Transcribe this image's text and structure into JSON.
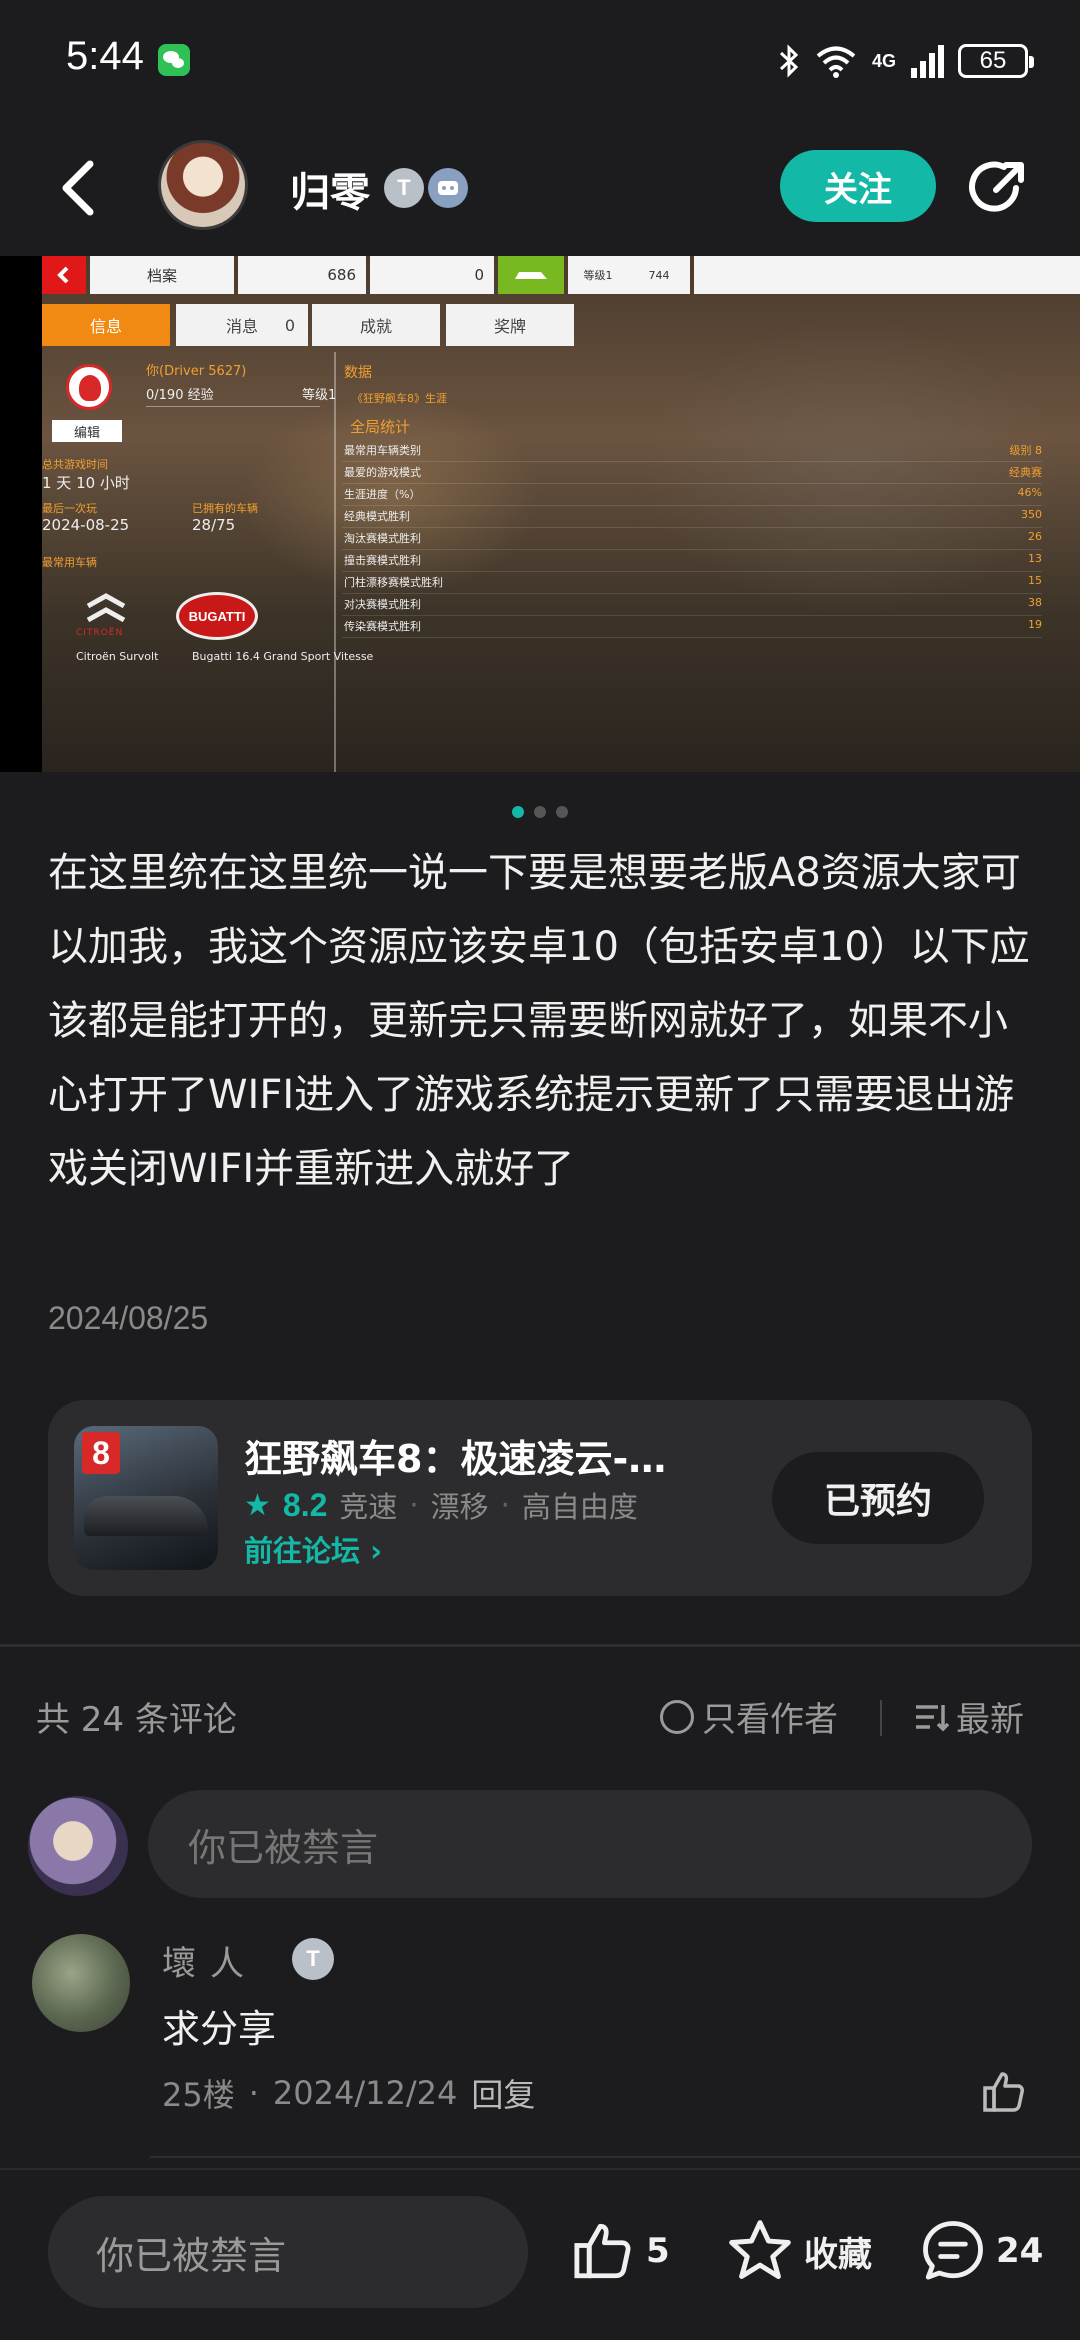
{
  "status_bar": {
    "time": "5:44",
    "network": "4G",
    "battery": "65"
  },
  "header": {
    "username": "归零",
    "badge_level": "T",
    "follow_label": "关注"
  },
  "screenshot": {
    "tabs_top": [
      "档案",
      "686",
      "0",
      "等级1",
      "744"
    ],
    "tabs": [
      "信息",
      "消息",
      "0",
      "成就",
      "奖牌"
    ],
    "driver": "你(Driver 5627)",
    "xp": "0/190 经验",
    "level": "等级1",
    "edit": "编辑",
    "total_time_label": "总共游戏时间",
    "total_time": "1 天 10 小时",
    "last_played_label": "最后一次玩",
    "last_played": "2024-08-25",
    "owned_label": "已拥有的车辆",
    "owned": "28/75",
    "fav_label": "最常用车辆",
    "car1_brand": "CITROËN",
    "car1": "Citroën Survolt",
    "car2_brand": "BUGATTI",
    "car2": "Bugatti 16.4 Grand Sport Vitesse",
    "data_label": "数据",
    "career_label": "《狂野飙车8》生涯",
    "global_label": "全局统计",
    "stats": [
      {
        "label": "最常用车辆类别",
        "value": "级别 8"
      },
      {
        "label": "最爱的游戏模式",
        "value": "经典赛"
      },
      {
        "label": "生涯进度（%）",
        "value": "46%"
      },
      {
        "label": "经典模式胜利",
        "value": "350"
      },
      {
        "label": "淘汰赛模式胜利",
        "value": "26"
      },
      {
        "label": "撞击赛模式胜利",
        "value": "13"
      },
      {
        "label": "门柱漂移赛模式胜利",
        "value": "15"
      },
      {
        "label": "对决赛模式胜利",
        "value": "38"
      },
      {
        "label": "传染赛模式胜利",
        "value": "19"
      }
    ]
  },
  "post": {
    "text": "在这里统在这里统一说一下要是想要老版A8资源大家可以加我，我这个资源应该安卓10（包括安卓10）以下应该都是能打开的，更新完只需要断网就好了，如果不小心打开了WIFI进入了游戏系统提示更新了只需要退出游戏关闭WIFI并重新进入就好了",
    "date": "2024/08/25"
  },
  "game_card": {
    "icon_number": "8",
    "title": "狂野飙车8：极速凌云-…",
    "rating": "8.2",
    "tags": [
      "竞速",
      "漂移",
      "高自由度"
    ],
    "forum_link": "前往论坛",
    "reserved_label": "已预约"
  },
  "comments_header": {
    "count_label": "共 24 条评论",
    "author_only": "只看作者",
    "sort": "最新"
  },
  "comment_input_placeholder": "你已被禁言",
  "comments": [
    {
      "name": "壞人",
      "badge": "T",
      "text": "求分享",
      "floor": "25楼",
      "date": "2024/12/24",
      "reply": "回复"
    }
  ],
  "bottom_bar": {
    "input_placeholder": "你已被禁言",
    "likes": "5",
    "favorite_label": "收藏",
    "comments": "24"
  },
  "colors": {
    "accent": "#14b8a6",
    "background": "#1c1c1e",
    "card": "#2c2c2e"
  }
}
